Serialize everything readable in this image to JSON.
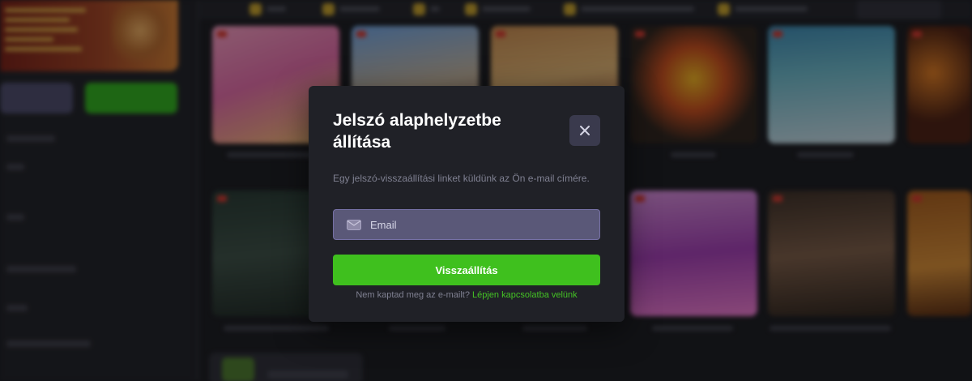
{
  "modal": {
    "title": "Jelszó alaphelyzetbe állítása",
    "description": "Egy jelszó-visszaállítási linket küldünk az Ön e-mail címére.",
    "email_placeholder": "Email",
    "submit_label": "Visszaállítás",
    "footer_text": "Nem kaptad meg az e-mailt?",
    "footer_link": "Lépjen kapcsolatba velünk"
  },
  "colors": {
    "primary_green": "#3fc01e",
    "link_green": "#44c325",
    "modal_bg": "#202127",
    "input_bg": "#5a5878",
    "close_bg": "#3a3a4d"
  },
  "icons": {
    "close": "close-icon",
    "email": "mail-icon"
  }
}
